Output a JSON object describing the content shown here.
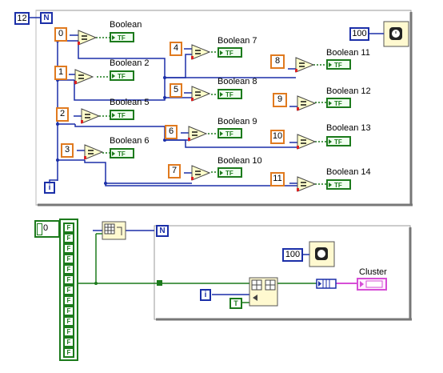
{
  "labels": {
    "count_terminal": "N",
    "iteration_terminal": "i",
    "count_value": "12",
    "wait_value": "100",
    "array_index": "0",
    "cluster_label": "Cluster",
    "true_constant": "T",
    "tf_text": "TF",
    "false_text": "F"
  },
  "constants": [
    "0",
    "1",
    "2",
    "3",
    "4",
    "5",
    "6",
    "7",
    "8",
    "9",
    "10",
    "11"
  ],
  "booleans": [
    "Boolean",
    "Boolean 2",
    "Boolean 5",
    "Boolean 6",
    "Boolean 7",
    "Boolean 8",
    "Boolean 9",
    "Boolean 10",
    "Boolean 11",
    "Boolean 12",
    "Boolean 13",
    "Boolean 14"
  ],
  "colors": {
    "int_wire": "#1b2fa8",
    "bool_wire": "#1c7a1c",
    "constant_border": "#e07a1f",
    "cluster_pink": "#d64ed6",
    "frame": "#888888",
    "comparator_fill": "#ffffcc"
  },
  "icons": [
    "wait-ms-icon",
    "equal-comparator-icon",
    "array-size-icon",
    "build-array-icon",
    "bundle-icon",
    "for-loop-frame-icon"
  ]
}
